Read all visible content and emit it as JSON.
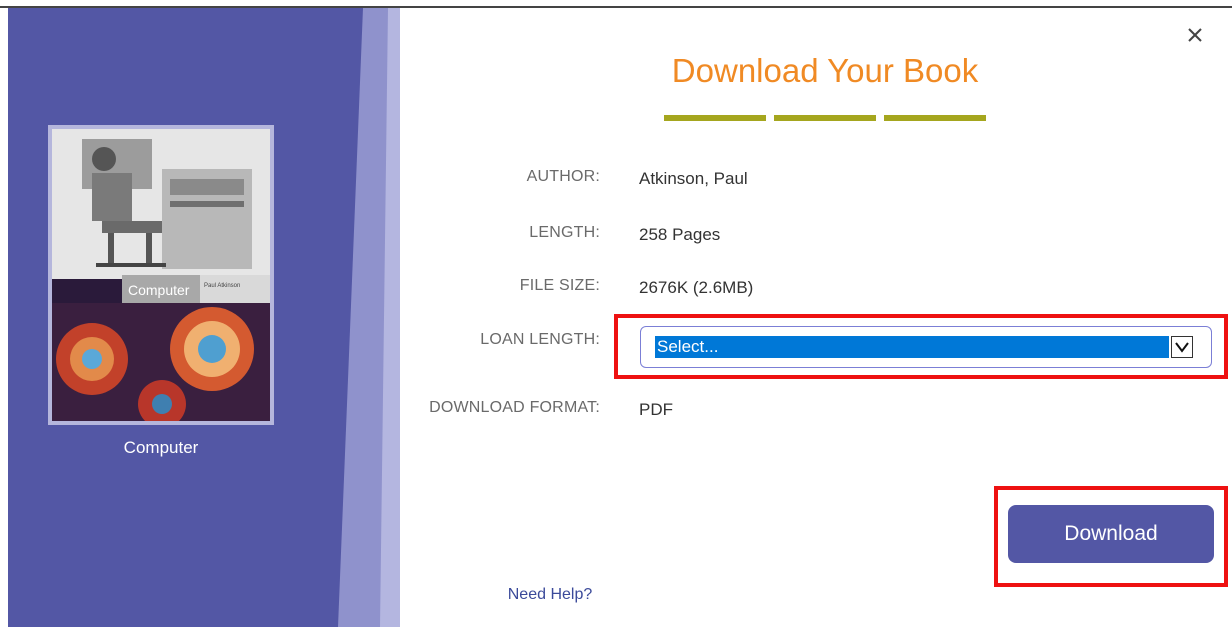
{
  "book": {
    "cover_caption": "Computer",
    "cover_title": "Computer",
    "cover_author": "Paul Atkinson"
  },
  "dialog": {
    "title": "Download Your Book",
    "close_glyph": "×",
    "help_link": "Need Help?"
  },
  "details": {
    "author_label": "AUTHOR:",
    "author_value": "Atkinson, Paul",
    "length_label": "LENGTH:",
    "length_value": "258 Pages",
    "file_size_label": "FILE SIZE:",
    "file_size_value": "2676K (2.6MB)",
    "loan_length_label": "LOAN LENGTH:",
    "loan_length_selected": "Select...",
    "download_format_label": "DOWNLOAD FORMAT:",
    "download_format_value": "PDF"
  },
  "actions": {
    "download_label": "Download"
  },
  "colors": {
    "panel": "#5357a5",
    "title": "#f08a24",
    "title_bars": "#a5a61e",
    "highlight": "#ee1111",
    "select_fill": "#0078d7"
  }
}
